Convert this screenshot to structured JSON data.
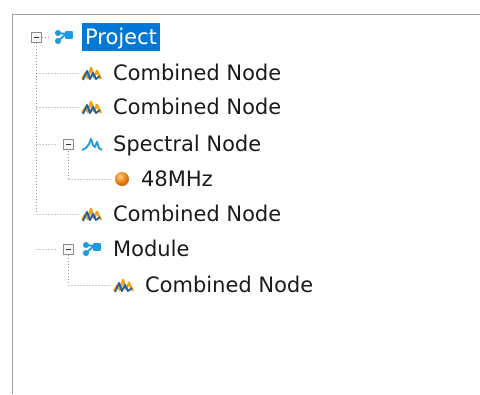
{
  "tree": {
    "nodes": [
      {
        "label": "Project",
        "icon": "project-network-icon",
        "selected": true,
        "expanded": true
      },
      {
        "label": "Combined Node",
        "icon": "combined-node-icon"
      },
      {
        "label": "Combined Node",
        "icon": "combined-node-icon"
      },
      {
        "label": "Spectral Node",
        "icon": "spectral-waveform-icon",
        "expanded": true
      },
      {
        "label": "48MHz",
        "icon": "orange-dot-icon"
      },
      {
        "label": "Combined Node",
        "icon": "combined-node-icon"
      },
      {
        "label": "Module",
        "icon": "module-network-icon",
        "expanded": true
      },
      {
        "label": "Combined Node",
        "icon": "combined-node-icon"
      }
    ]
  },
  "colors": {
    "selection": "#0078d7",
    "network_icon": "#1e9be0",
    "wave_orange": "#f2a20c",
    "wave_blue": "#1f5fa8",
    "dot_orange": "#f08c1e"
  }
}
